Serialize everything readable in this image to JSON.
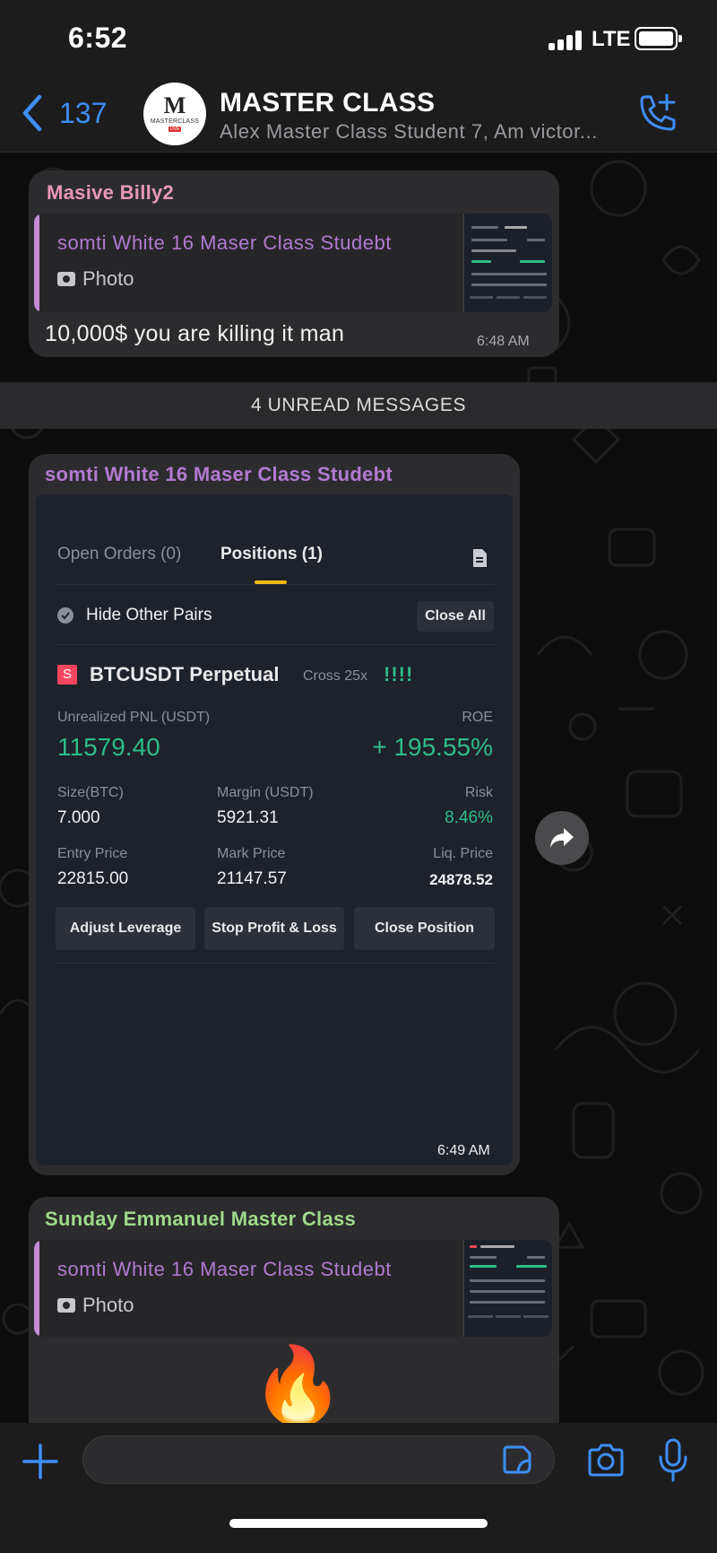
{
  "status_bar": {
    "time": "6:52",
    "network": "LTE"
  },
  "header": {
    "back_count": "137",
    "title": "MASTER CLASS",
    "subtitle": "Alex Master Class Student 7, Am victor...",
    "avatar": {
      "letter": "M",
      "brand": "MASTERCLASS",
      "badge": "LIVE"
    }
  },
  "messages": [
    {
      "sender": "Masive Billy2",
      "sender_color": "#e898b5",
      "reply_to": {
        "name": "somti White 16 Maser Class Studebt",
        "type": "Photo"
      },
      "text": "10,000$ you are killing it man",
      "time": "6:48 AM"
    },
    {
      "sender": "somti White 16 Maser Class Studebt",
      "sender_color": "#b27ad0",
      "time": "6:49 AM",
      "photo": {
        "tab_open_orders": "Open Orders (0)",
        "tab_positions": "Positions (1)",
        "hide_other_pairs": "Hide Other Pairs",
        "close_all": "Close All",
        "side_badge": "S",
        "symbol": "BTCUSDT Perpetual",
        "margin_mode": "Cross 25x",
        "strength": "!!!!",
        "pnl_label": "Unrealized PNL (USDT)",
        "pnl_value": "11579.40",
        "roe_label": "ROE",
        "roe_value": "+ 195.55%",
        "size_label": "Size(BTC)",
        "size_value": "7.000",
        "margin_label": "Margin (USDT)",
        "margin_value": "5921.31",
        "risk_label": "Risk",
        "risk_value": "8.46%",
        "entry_label": "Entry Price",
        "entry_value": "22815.00",
        "mark_label": "Mark Price",
        "mark_value": "21147.57",
        "liq_label": "Liq. Price",
        "liq_value": "24878.52",
        "btn_adjust": "Adjust Leverage",
        "btn_stop": "Stop Profit & Loss",
        "btn_close": "Close Position"
      }
    },
    {
      "sender": "Sunday Emmanuel Master Class",
      "sender_color": "#9fd98a",
      "reply_to": {
        "name": "somti White 16 Maser Class Studebt",
        "type": "Photo"
      },
      "emoji": "🔥"
    }
  ],
  "unread_divider": "4 UNREAD MESSAGES",
  "colors": {
    "accent": "#3e8ef7",
    "profit": "#2ebd85",
    "sell": "#f6465d",
    "binance_yellow": "#f0b90b"
  }
}
